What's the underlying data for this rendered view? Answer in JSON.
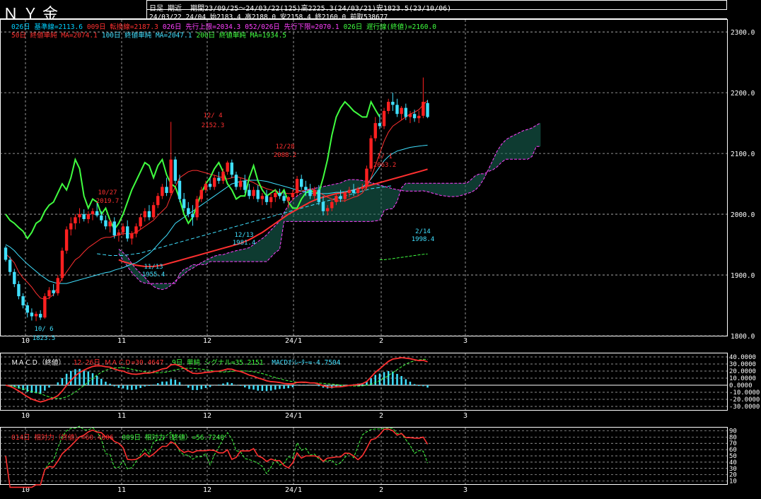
{
  "header": {
    "title": "ＮＹ金",
    "mode": "日足 期近",
    "period_line": "期間23/09/25～24/03/22(125)高2225.3(24/03/21)安1823.5(23/10/06)",
    "quote_line": "24/03/22 24/04 始2183.4 高2188.0 安2158.4 終2160.0 前取538677"
  },
  "legend_main_1": [
    {
      "text": "026日 基準線=2113.6",
      "color": "#00d0ff"
    },
    {
      "text": "009日 転換線=2187.3",
      "color": "#ff3030"
    },
    {
      "text": "026日 先行上限=2034.3",
      "color": "#ff40ff"
    },
    {
      "text": "052/026日 先行下限=2070.1",
      "color": "#ff40ff"
    },
    {
      "text": "026日 遅行線(終値)=2160.0",
      "color": "#40ff40"
    }
  ],
  "legend_main_2": [
    {
      "text": "50日 終値単純 MA=2074.1",
      "color": "#ff3030"
    },
    {
      "text": "100日 終値単純 MA=2047.1",
      "color": "#40e0ff"
    },
    {
      "text": "200日 終値単純 MA=1934.5",
      "color": "#40ff40"
    }
  ],
  "legend_macd": {
    "name": "ＭＡＣＤ（終値）",
    "macd": "12-26日 ＭＡＣＤ=30.4647",
    "signal": "9日 単純 シグナル=35.2151",
    "osc": "MACDｵｼﾚｰﾀｰ=-4.7504",
    "macd_color": "#ff3030",
    "signal_color": "#40ff40",
    "osc_color": "#40e0ff"
  },
  "legend_rsi": {
    "rsi14": "014日 相対力（終値）=60.4606",
    "rsi9": "009日 相対力（終値）=56.7240",
    "rsi14_color": "#ff3030",
    "rsi9_color": "#40ff40"
  },
  "x_labels": [
    "10",
    "11",
    "12",
    "24/1",
    "2",
    "3"
  ],
  "price_ticks": [
    "2300.0",
    "2200.0",
    "2100.0",
    "2000.0",
    "1900.0",
    "1800.0"
  ],
  "macd_ticks": [
    "40.0000",
    "30.0000",
    "20.0000",
    "10.0000",
    "0.0000",
    "-10.0000",
    "-20.0000",
    "-30.0000"
  ],
  "rsi_ticks": [
    "90",
    "80",
    "70",
    "60",
    "50",
    "40",
    "30",
    "20",
    "10"
  ],
  "annotations": [
    {
      "text": "10/ 6",
      "color": "#40e0ff"
    },
    {
      "text": "1823.5",
      "color": "#40e0ff"
    },
    {
      "text": "10/27",
      "color": "#ff3030"
    },
    {
      "text": "2019.7",
      "color": "#ff3030"
    },
    {
      "text": "11/13",
      "color": "#40e0ff"
    },
    {
      "text": "1955.4",
      "color": "#40e0ff"
    },
    {
      "text": "12/ 4",
      "color": "#ff3030"
    },
    {
      "text": "2152.3",
      "color": "#ff3030"
    },
    {
      "text": "12/13",
      "color": "#40e0ff"
    },
    {
      "text": "1981.4",
      "color": "#40e0ff"
    },
    {
      "text": "12/28",
      "color": "#ff3030"
    },
    {
      "text": "2088.2",
      "color": "#ff3030"
    },
    {
      "text": "2/ 1",
      "color": "#ff3030"
    },
    {
      "text": "2063.2",
      "color": "#ff3030"
    },
    {
      "text": "2/14",
      "color": "#40e0ff"
    },
    {
      "text": "1998.4",
      "color": "#40e0ff"
    }
  ],
  "chart_data": {
    "type": "candlestick",
    "ylim": [
      1800,
      2320
    ],
    "macd_ylim": [
      -35,
      45
    ],
    "rsi_ylim": [
      5,
      95
    ],
    "candles_ohlc": [
      [
        1945,
        1948,
        1922,
        1925
      ],
      [
        1925,
        1930,
        1900,
        1905
      ],
      [
        1905,
        1910,
        1880,
        1885
      ],
      [
        1885,
        1890,
        1860,
        1865
      ],
      [
        1865,
        1870,
        1845,
        1850
      ],
      [
        1850,
        1855,
        1830,
        1838
      ],
      [
        1838,
        1845,
        1825,
        1832
      ],
      [
        1832,
        1840,
        1824,
        1836
      ],
      [
        1836,
        1842,
        1826,
        1830
      ],
      [
        1830,
        1870,
        1828,
        1865
      ],
      [
        1865,
        1880,
        1860,
        1875
      ],
      [
        1875,
        1885,
        1865,
        1870
      ],
      [
        1870,
        1900,
        1866,
        1895
      ],
      [
        1895,
        1945,
        1890,
        1940
      ],
      [
        1940,
        1980,
        1935,
        1975
      ],
      [
        1975,
        1995,
        1965,
        1985
      ],
      [
        1985,
        2000,
        1975,
        1995
      ],
      [
        1995,
        2010,
        1985,
        2000
      ],
      [
        2000,
        2008,
        1988,
        1992
      ],
      [
        1992,
        2005,
        1985,
        2000
      ],
      [
        2000,
        2010,
        1990,
        2005
      ],
      [
        2005,
        2020,
        1995,
        1998
      ],
      [
        1998,
        2005,
        1985,
        1990
      ],
      [
        1990,
        1998,
        1975,
        1980
      ],
      [
        1980,
        1992,
        1970,
        1988
      ],
      [
        1988,
        1995,
        1960,
        1965
      ],
      [
        1965,
        1975,
        1955,
        1970
      ],
      [
        1970,
        1985,
        1965,
        1980
      ],
      [
        1980,
        1990,
        1955,
        1960
      ],
      [
        1960,
        1972,
        1950,
        1968
      ],
      [
        1968,
        1985,
        1962,
        1980
      ],
      [
        1980,
        2000,
        1975,
        1995
      ],
      [
        1995,
        2010,
        1988,
        2005
      ],
      [
        2005,
        2015,
        1990,
        1995
      ],
      [
        1995,
        2020,
        1992,
        2015
      ],
      [
        2015,
        2035,
        2010,
        2030
      ],
      [
        2030,
        2050,
        2025,
        2045
      ],
      [
        2045,
        2060,
        2030,
        2035
      ],
      [
        2035,
        2152,
        2030,
        2090
      ],
      [
        2090,
        2095,
        2050,
        2055
      ],
      [
        2055,
        2065,
        2020,
        2025
      ],
      [
        2025,
        2035,
        2005,
        2010
      ],
      [
        2010,
        2020,
        1995,
        2000
      ],
      [
        2000,
        2015,
        1981,
        1995
      ],
      [
        1995,
        2030,
        1990,
        2025
      ],
      [
        2025,
        2045,
        2020,
        2040
      ],
      [
        2040,
        2055,
        2035,
        2050
      ],
      [
        2050,
        2060,
        2040,
        2045
      ],
      [
        2045,
        2065,
        2040,
        2060
      ],
      [
        2060,
        2070,
        2050,
        2055
      ],
      [
        2055,
        2075,
        2050,
        2070
      ],
      [
        2070,
        2088,
        2065,
        2085
      ],
      [
        2085,
        2090,
        2060,
        2065
      ],
      [
        2065,
        2070,
        2040,
        2045
      ],
      [
        2045,
        2060,
        2040,
        2055
      ],
      [
        2055,
        2065,
        2035,
        2040
      ],
      [
        2040,
        2050,
        2025,
        2030
      ],
      [
        2030,
        2045,
        2025,
        2040
      ],
      [
        2040,
        2048,
        2020,
        2025
      ],
      [
        2025,
        2035,
        2015,
        2030
      ],
      [
        2030,
        2040,
        2015,
        2020
      ],
      [
        2020,
        2035,
        2010,
        2028
      ],
      [
        2028,
        2040,
        2020,
        2035
      ],
      [
        2035,
        2042,
        2025,
        2030
      ],
      [
        2030,
        2038,
        2018,
        2022
      ],
      [
        2022,
        2030,
        2010,
        2028
      ],
      [
        2028,
        2040,
        2022,
        2035
      ],
      [
        2035,
        2063,
        2030,
        2058
      ],
      [
        2058,
        2065,
        2040,
        2045
      ],
      [
        2045,
        2055,
        2030,
        2040
      ],
      [
        2040,
        2050,
        2025,
        2030
      ],
      [
        2030,
        2045,
        2025,
        2040
      ],
      [
        2040,
        2048,
        2015,
        2020
      ],
      [
        2020,
        2030,
        1998,
        2005
      ],
      [
        2005,
        2015,
        1998,
        2010
      ],
      [
        2010,
        2025,
        2005,
        2020
      ],
      [
        2020,
        2035,
        2015,
        2030
      ],
      [
        2030,
        2040,
        2020,
        2025
      ],
      [
        2025,
        2038,
        2020,
        2035
      ],
      [
        2035,
        2045,
        2028,
        2040
      ],
      [
        2040,
        2050,
        2030,
        2035
      ],
      [
        2035,
        2045,
        2030,
        2042
      ],
      [
        2042,
        2050,
        2038,
        2045
      ],
      [
        2045,
        2080,
        2040,
        2075
      ],
      [
        2075,
        2130,
        2070,
        2125
      ],
      [
        2125,
        2160,
        2120,
        2150
      ],
      [
        2150,
        2165,
        2140,
        2145
      ],
      [
        2145,
        2175,
        2140,
        2170
      ],
      [
        2170,
        2190,
        2165,
        2185
      ],
      [
        2185,
        2200,
        2170,
        2180
      ],
      [
        2180,
        2190,
        2160,
        2165
      ],
      [
        2165,
        2178,
        2155,
        2175
      ],
      [
        2175,
        2182,
        2155,
        2160
      ],
      [
        2160,
        2170,
        2150,
        2165
      ],
      [
        2165,
        2172,
        2152,
        2158
      ],
      [
        2158,
        2170,
        2150,
        2162
      ],
      [
        2162,
        2225,
        2158,
        2185
      ],
      [
        2183,
        2188,
        2158,
        2160
      ]
    ],
    "tenkan": [
      1935,
      1928,
      1920,
      1905,
      1895,
      1888,
      1880,
      1870,
      1862,
      1860,
      1862,
      1868,
      1880,
      1895,
      1905,
      1915,
      1925,
      1930,
      1938,
      1945,
      1950,
      1955,
      1960,
      1962,
      1962,
      1964,
      1966,
      1968,
      1968,
      1968,
      1970,
      1975,
      1980,
      1985,
      1990,
      1998,
      2005,
      2012,
      2030,
      2045,
      2060,
      2065,
      2070,
      2072,
      2072,
      2070,
      2068,
      2066,
      2064,
      2062,
      2060,
      2058,
      2060,
      2062,
      2060,
      2058,
      2055,
      2052,
      2048,
      2045,
      2042,
      2040,
      2038,
      2036,
      2035,
      2034,
      2034,
      2036,
      2038,
      2040,
      2042,
      2040,
      2036,
      2032,
      2028,
      2025,
      2022,
      2022,
      2022,
      2025,
      2028,
      2030,
      2035,
      2045,
      2060,
      2080,
      2100,
      2120,
      2135,
      2145,
      2150,
      2155,
      2160,
      2165,
      2168,
      2172,
      2180,
      2187.3
    ],
    "kijun": [
      1950,
      1946,
      1940,
      1932,
      1925,
      1918,
      1912,
      1906,
      1900,
      1895,
      1890,
      1888,
      1886,
      1886,
      1886,
      1888,
      1890,
      1892,
      1894,
      1896,
      1898,
      1900,
      1902,
      1904,
      1905,
      1908,
      1910,
      1912,
      1915,
      1918,
      1920,
      1925,
      1930,
      1935,
      1942,
      1950,
      1958,
      1965,
      1975,
      1985,
      1990,
      1995,
      2000,
      2005,
      2010,
      2015,
      2020,
      2025,
      2030,
      2035,
      2040,
      2045,
      2050,
      2052,
      2054,
      2055,
      2056,
      2056,
      2056,
      2055,
      2054,
      2052,
      2050,
      2048,
      2046,
      2044,
      2042,
      2040,
      2038,
      2036,
      2035,
      2034,
      2034,
      2034,
      2034,
      2035,
      2036,
      2036,
      2037,
      2038,
      2040,
      2042,
      2045,
      2050,
      2058,
      2068,
      2078,
      2088,
      2095,
      2100,
      2104,
      2106,
      2108,
      2110,
      2111,
      2112,
      2113,
      2113.6
    ],
    "ma50": [
      1925,
      1922,
      1920,
      1918,
      1916,
      1915,
      1914,
      1914,
      1914,
      1915,
      1916,
      1918,
      1920,
      1922,
      1924,
      1926,
      1928,
      1930,
      1932,
      1934,
      1936,
      1938,
      1940,
      1942,
      1944,
      1946,
      1948,
      1950,
      1952,
      1955,
      1958,
      1962,
      1966,
      1970,
      1975,
      1980,
      1985,
      1990,
      1995,
      2000,
      2004,
      2008,
      2012,
      2016,
      2020,
      2023,
      2026,
      2028,
      2030,
      2032,
      2034,
      2035,
      2036,
      2038,
      2040,
      2042,
      2044,
      2046,
      2048,
      2050,
      2052,
      2054,
      2056,
      2058,
      2060,
      2062,
      2064,
      2066,
      2068,
      2070,
      2072,
      2074.1
    ],
    "ma100": [
      1935,
      1934,
      1933,
      1932,
      1932,
      1932,
      1932,
      1933,
      1934,
      1935,
      1936,
      1938,
      1940,
      1942,
      1944,
      1946,
      1948,
      1950,
      1952,
      1954,
      1956,
      1958,
      1960,
      1962,
      1964,
      1966,
      1968,
      1970,
      1972,
      1974,
      1976,
      1978,
      1980,
      1982,
      1984,
      1986,
      1988,
      1990,
      1992,
      1994,
      1996,
      1998,
      2000,
      2002,
      2004,
      2006,
      2008,
      2010,
      2012,
      2014,
      2016,
      2018,
      2020,
      2022,
      2024,
      2026,
      2028,
      2030,
      2032,
      2034,
      2036,
      2038,
      2040,
      2042,
      2043,
      2044,
      2045,
      2046,
      2047.1
    ],
    "ma200": [
      1925,
      1925,
      1926,
      1927,
      1928,
      1929,
      1930,
      1931,
      1932,
      1933,
      1934,
      1934.5
    ],
    "chikou": [
      2000,
      1990,
      1985,
      1978,
      1972,
      1960,
      1970,
      1985,
      1990,
      2005,
      2015,
      2020,
      2035,
      2050,
      2040,
      2060,
      2090,
      2075,
      2030,
      2010,
      2025,
      2020,
      2000,
      2010,
      1990,
      1975,
      1985,
      2000,
      2020,
      2040,
      2055,
      2070,
      2085,
      2080,
      2060,
      2080,
      2090,
      2065,
      2050,
      2045,
      2025,
      2000,
      1985,
      1995,
      2015,
      2035,
      2050,
      2060,
      2075,
      2085,
      2070,
      2050,
      2040,
      2025,
      2030,
      2030,
      2060,
      2080,
      2055,
      2040,
      2030,
      2035,
      2040,
      2030,
      2040,
      2020,
      2010,
      2010,
      2025,
      2035,
      2040,
      2035,
      2035,
      2060,
      2090,
      2130,
      2160,
      2175,
      2185,
      2178,
      2170,
      2165,
      2160,
      2160,
      2185,
      2172,
      2160
    ]
  }
}
